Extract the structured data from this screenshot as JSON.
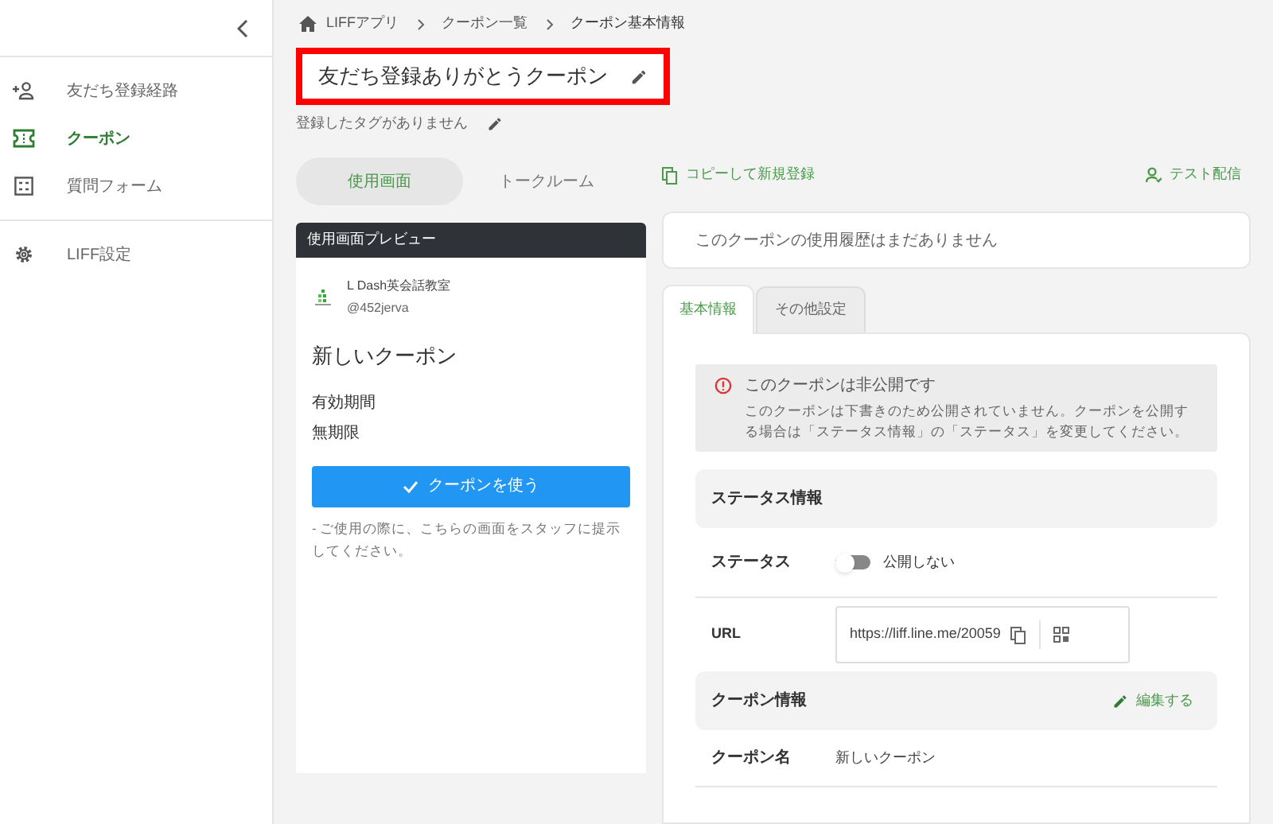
{
  "sidebar": {
    "items": [
      {
        "label": "友だち登録経路",
        "selected": false
      },
      {
        "label": "クーポン",
        "selected": true
      },
      {
        "label": "質問フォーム",
        "selected": false
      },
      {
        "label": "LIFF設定",
        "selected": false
      }
    ]
  },
  "breadcrumb": [
    "LIFFアプリ",
    "クーポン一覧",
    "クーポン基本情報"
  ],
  "title": "友だち登録ありがとうクーポン",
  "tags_text": "登録したタグがありません",
  "preview_tabs": [
    {
      "label": "使用画面",
      "selected": true
    },
    {
      "label": "トークルーム",
      "selected": false
    }
  ],
  "preview": {
    "header": "使用画面プレビュー",
    "account_name": "L Dash英会話教室",
    "account_id": "@452jerva",
    "coupon_name": "新しいクーポン",
    "period_label": "有効期間",
    "period_value": "無期限",
    "use_button": "クーポンを使う",
    "note": "- ご使用の際に、こちらの画面をスタッフに提示してください。"
  },
  "actions": {
    "copy": "コピーして新規登録",
    "test": "テスト配信"
  },
  "history_text": "このクーポンの使用履歴はまだありません",
  "detail_tabs": [
    {
      "label": "基本情報",
      "selected": true
    },
    {
      "label": "その他設定",
      "selected": false
    }
  ],
  "alert": {
    "title": "このクーポンは非公開です",
    "body": "このクーポンは下書きのため公開されていません。クーポンを公開する場合は「ステータス情報」の「ステータス」を変更してください。"
  },
  "status_section": {
    "title": "ステータス情報",
    "status_label": "ステータス",
    "status_on": false,
    "status_text": "公開しない",
    "url_label": "URL",
    "url_value": "https://liff.line.me/20059"
  },
  "coupon_section": {
    "title": "クーポン情報",
    "edit": "編集する",
    "name_label": "クーポン名",
    "name_value": "新しいクーポン"
  }
}
